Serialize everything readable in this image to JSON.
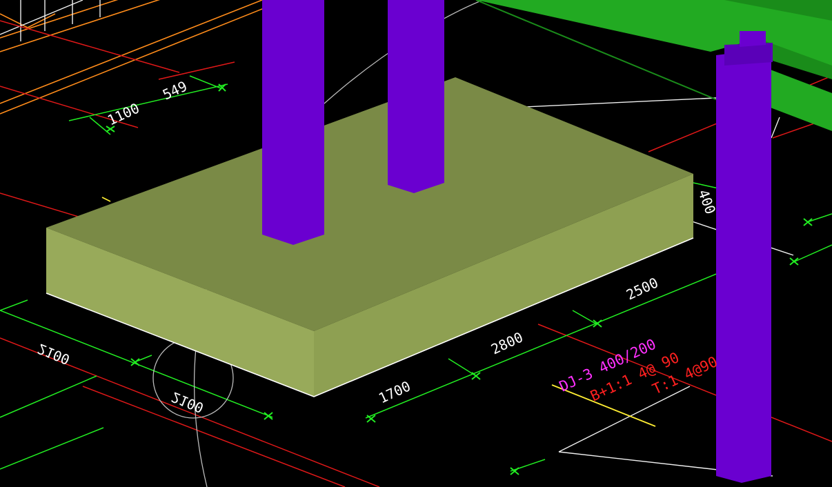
{
  "colors": {
    "background": "#000000",
    "footing_top": "#7a8a46",
    "footing_front": "#98aa5a",
    "footing_side": "#8ea052",
    "column": "#6a00d0",
    "column_side": "#5a00b8",
    "beam": "#22aa22",
    "beam_dark": "#1a8c1a",
    "grid_red": "#e01818",
    "dimension_green": "#22ee22",
    "dimension_white": "#ffffff",
    "label_magenta": "#ff30ff",
    "label_red": "#ff2020",
    "orange": "#ff8c1a",
    "yellow": "#ffee33",
    "arc_gray": "#bbbbbb"
  },
  "dimensions": {
    "d1": "1100",
    "d2": "549",
    "d3": "2100",
    "d4": "2100",
    "d5": "1700",
    "d6": "2800",
    "d7": "2500",
    "d8": "400"
  },
  "labels": {
    "beam_tag": "DJ-3 400/200",
    "beam_reinf_1": "B+1:1 4@ 90",
    "beam_reinf_2": "T:1 4@90"
  }
}
